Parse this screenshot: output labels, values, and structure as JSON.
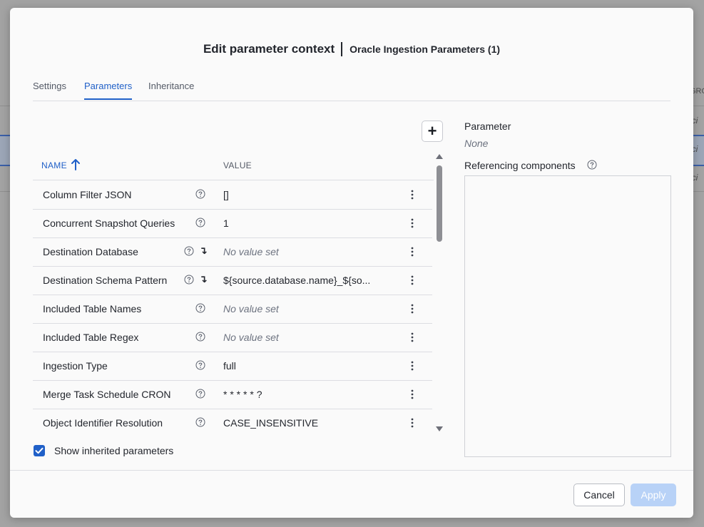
{
  "background": {
    "column_header_fragment": "GRO",
    "row_fragments": [
      "ici",
      "ici",
      "ici"
    ]
  },
  "dialog": {
    "title": "Edit parameter context",
    "subtitle": "Oracle Ingestion Parameters (1)"
  },
  "tabs": [
    {
      "label": "Settings",
      "active": false
    },
    {
      "label": "Parameters",
      "active": true
    },
    {
      "label": "Inheritance",
      "active": false
    }
  ],
  "add_button": {
    "label": "+"
  },
  "table": {
    "columns": {
      "name": "NAME",
      "value": "VALUE"
    },
    "sort": {
      "column": "NAME",
      "direction": "ascending"
    },
    "rows": [
      {
        "name": "Column Filter JSON",
        "value": "[]",
        "empty": false,
        "inherited": false
      },
      {
        "name": "Concurrent Snapshot Queries",
        "value": "1",
        "empty": false,
        "inherited": false
      },
      {
        "name": "Destination Database",
        "value": "No value set",
        "empty": true,
        "inherited": true
      },
      {
        "name": "Destination Schema Pattern",
        "value": "${source.database.name}_${so...",
        "empty": false,
        "inherited": true
      },
      {
        "name": "Included Table Names",
        "value": "No value set",
        "empty": true,
        "inherited": false
      },
      {
        "name": "Included Table Regex",
        "value": "No value set",
        "empty": true,
        "inherited": false
      },
      {
        "name": "Ingestion Type",
        "value": "full",
        "empty": false,
        "inherited": false
      },
      {
        "name": "Merge Task Schedule CRON",
        "value": "* * * * * ?",
        "empty": false,
        "inherited": false
      },
      {
        "name": "Object Identifier Resolution",
        "value": "CASE_INSENSITIVE",
        "empty": false,
        "inherited": false
      }
    ]
  },
  "show_inherited": {
    "label": "Show inherited parameters",
    "checked": true
  },
  "details": {
    "parameter_label": "Parameter",
    "parameter_value": "None",
    "referencing_label": "Referencing components"
  },
  "footer": {
    "cancel_label": "Cancel",
    "apply_label": "Apply"
  },
  "colors": {
    "accent": "#2060c8",
    "apply_disabled": "#b8d2f7",
    "overlay": "#9e9e9e"
  }
}
